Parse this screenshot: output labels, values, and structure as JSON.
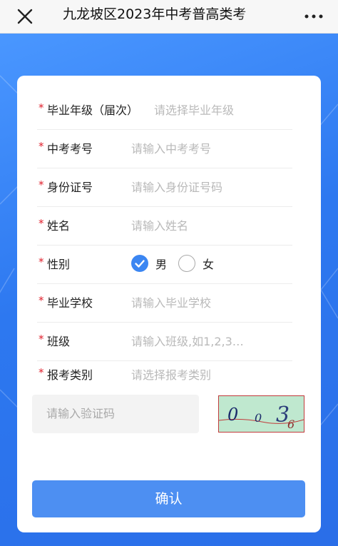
{
  "header": {
    "title": "九龙坡区2023年中考普高类考",
    "close_icon": "close-icon",
    "more_icon": "more-dots-icon"
  },
  "form": {
    "fields": [
      {
        "required_mark": "*",
        "label": "毕业年级（届次）",
        "placeholder": "请选择毕业年级",
        "type": "select"
      },
      {
        "required_mark": "*",
        "label": "中考考号",
        "placeholder": "请输入中考考号",
        "type": "text"
      },
      {
        "required_mark": "*",
        "label": "身份证号",
        "placeholder": "请输入身份证号码",
        "type": "text"
      },
      {
        "required_mark": "*",
        "label": "姓名",
        "placeholder": "请输入姓名",
        "type": "text"
      },
      {
        "required_mark": "*",
        "label": "性别",
        "type": "radio"
      },
      {
        "required_mark": "*",
        "label": "毕业学校",
        "placeholder": "请输入毕业学校",
        "type": "text"
      },
      {
        "required_mark": "*",
        "label": "班级",
        "placeholder": "请输入班级,如1,2,3…",
        "type": "text"
      },
      {
        "required_mark": "*",
        "label": "报考类别",
        "placeholder": "请选择报考类别",
        "type": "select"
      }
    ],
    "gender": {
      "options": [
        "男",
        "女"
      ],
      "selected": "男"
    },
    "captcha": {
      "placeholder": "请输入验证码",
      "image_text": "0036"
    },
    "submit_label": "确认"
  },
  "colors": {
    "primary": "#3b86f2",
    "required": "#e0202d",
    "background": "#2f7ef0"
  }
}
